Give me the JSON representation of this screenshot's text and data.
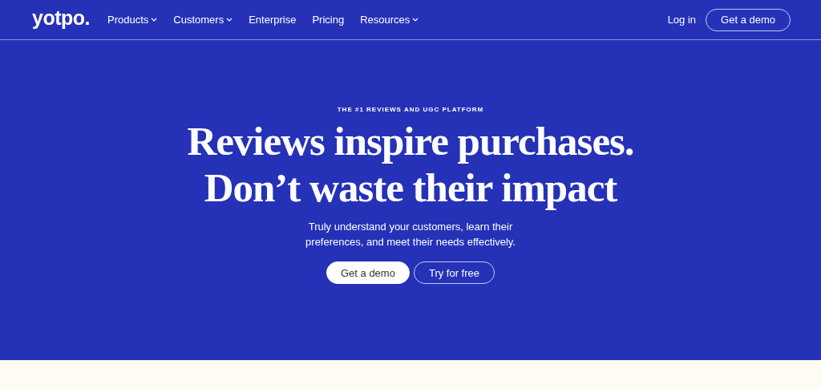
{
  "nav": {
    "logo": "yotpo.",
    "items": [
      {
        "label": "Products",
        "dropdown": true
      },
      {
        "label": "Customers",
        "dropdown": true
      },
      {
        "label": "Enterprise",
        "dropdown": false
      },
      {
        "label": "Pricing",
        "dropdown": false
      },
      {
        "label": "Resources",
        "dropdown": true
      }
    ],
    "actions": [
      {
        "label": "Log in",
        "kind": "link"
      },
      {
        "label": "Get a demo",
        "kind": "outline"
      }
    ]
  },
  "hero": {
    "eyebrow": "THE #1 REVIEWS AND UGC PLATFORM",
    "headline": [
      "Reviews inspire purchases.",
      "Don’t waste their impact"
    ],
    "subtitle": "Truly understand your customers, learn their preferences, and meet their needs effectively.",
    "buttons": [
      {
        "label": "Get a demo",
        "kind": "filled"
      },
      {
        "label": "Try for free",
        "kind": "outline"
      }
    ]
  }
}
